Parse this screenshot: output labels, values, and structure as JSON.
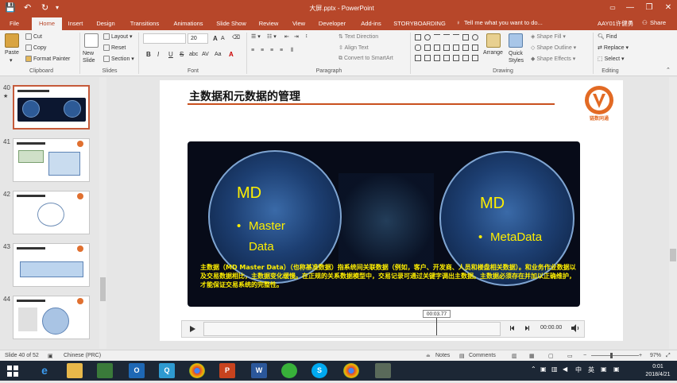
{
  "titlebar": {
    "title": "大屏.pptx - PowerPoint",
    "minimize": "—",
    "restore": "❐",
    "close": "✕",
    "save_icon": "💾",
    "undo": "↶",
    "redo": "↻"
  },
  "tabs": [
    "File",
    "Home",
    "Insert",
    "Design",
    "Transitions",
    "Animations",
    "Slide Show",
    "Review",
    "View",
    "Developer",
    "Add-ins",
    "STORYBOARDING"
  ],
  "active_tab": "Home",
  "tellme": "Tell me what you want to do...",
  "user": "AAY01许健勇",
  "share": "Share",
  "ribbon": {
    "clipboard": {
      "paste": "Paste",
      "cut": "Cut",
      "copy": "Copy",
      "format_painter": "Format Painter",
      "label": "Clipboard"
    },
    "slides": {
      "new_slide": "New Slide",
      "layout": "Layout",
      "reset": "Reset",
      "section": "Section",
      "label": "Slides"
    },
    "font": {
      "size": "20",
      "bold": "B",
      "italic": "I",
      "underline": "U",
      "strike": "S",
      "shadow": "abc",
      "spacing": "AV",
      "case": "Aa",
      "color": "A",
      "grow": "A",
      "shrink": "A",
      "label": "Font"
    },
    "paragraph": {
      "text_direction": "Text Direction",
      "align_text": "Align Text",
      "smartart": "Convert to SmartArt",
      "label": "Paragraph"
    },
    "drawing": {
      "arrange": "Arrange",
      "quick_styles": "Quick Styles",
      "shape_fill": "Shape Fill",
      "shape_outline": "Shape Outline",
      "shape_effects": "Shape Effects",
      "label": "Drawing"
    },
    "editing": {
      "find": "Find",
      "replace": "Replace",
      "select": "Select",
      "label": "Editing"
    }
  },
  "thumbnails": [
    {
      "num": "40",
      "star": "★"
    },
    {
      "num": "41"
    },
    {
      "num": "42"
    },
    {
      "num": "43"
    },
    {
      "num": "44"
    }
  ],
  "slide": {
    "title": "主数据和元数据的管理",
    "left_circle": {
      "heading": "MD",
      "bullet": "•",
      "line1": "Master",
      "line2": "Data"
    },
    "right_circle": {
      "heading": "MD",
      "bullet": "•",
      "line1": "MetaData"
    },
    "caption": "主数据（MD Master Data）（也称基准数据）指系统间关联数据（例如，客户、开发商、人员和楼盘相关数据）。和业务作业数据以及交易数据相比，主数据变化缓慢。在正规的关系数据模型中，交易记录可通过关键字调出主数据。主数据必须存在并加以正确维护，才能保证交易系统的完整性。",
    "logo_caption": "链数同通"
  },
  "media": {
    "time_tip": "00:03.77",
    "time": "00:00.00",
    "play_icon": "play-icon",
    "back_icon": "step-back-icon",
    "forward_icon": "step-forward-icon",
    "volume_icon": "volume-icon"
  },
  "status": {
    "slide_of": "Slide 40 of 52",
    "language": "Chinese (PRC)",
    "notes": "Notes",
    "comments": "Comments",
    "zoom": "97%"
  },
  "taskbar": {
    "time": "0:01",
    "date": "2018/4/21",
    "ime": "中",
    "lang": "英"
  },
  "colors": {
    "accent": "#b7472a",
    "title_line": "#c9501e",
    "caption_yellow": "#ffef00",
    "taskbar": "#1c2735"
  }
}
